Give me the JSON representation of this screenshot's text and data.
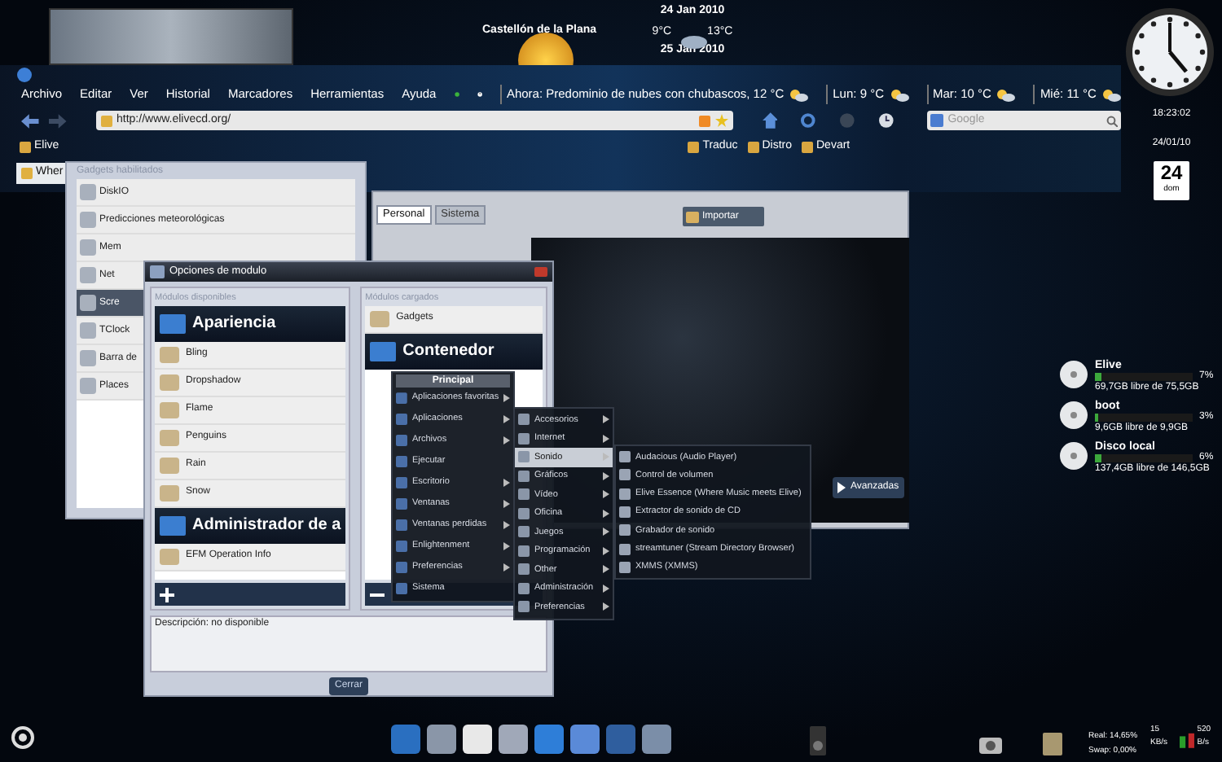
{
  "weather_gadget": {
    "city": "Castellón de la Plana",
    "date": "24 Jan 2010",
    "low": "9°C",
    "high": "13°C",
    "next_date": "25 Jan 2010"
  },
  "browser": {
    "menu": [
      "Archivo",
      "Editar",
      "Ver",
      "Historial",
      "Marcadores",
      "Herramientas",
      "Ayuda"
    ],
    "forecast": [
      "Ahora: Predominio de nubes con chubascos, 12 °C",
      "Lun: 9 °C",
      "Mar: 10 °C",
      "Mié: 11 °C"
    ],
    "url": "http://www.elivecd.org/",
    "search": {
      "placeholder": "Google"
    },
    "bookmarks": [
      "Elive",
      "Traduc",
      "Distro",
      "Devart"
    ],
    "tabs": [
      {
        "label": "Wher",
        "selected": true
      }
    ]
  },
  "clock_panel": {
    "time": "18:23:02",
    "date": "24/01/10",
    "calendar_day": "24",
    "calendar_weekday": "dom"
  },
  "gadgets_window": {
    "title": "Gadgets habilitados",
    "items": [
      {
        "label": "DiskIO",
        "selected": false
      },
      {
        "label": "Predicciones meteorológicas",
        "selected": false
      },
      {
        "label": "Mem",
        "selected": false
      },
      {
        "label": "Net",
        "selected": false
      },
      {
        "label": "Scre",
        "selected": true
      },
      {
        "label": "TClock",
        "selected": false
      },
      {
        "label": "Barra de",
        "selected": false
      },
      {
        "label": "Places",
        "selected": false
      }
    ]
  },
  "back_window": {
    "tabs": [
      {
        "label": "Personal",
        "selected": true
      },
      {
        "label": "Sistema",
        "selected": false
      }
    ],
    "import_button": "Importar",
    "advanced_button": "Avanzadas"
  },
  "module_window": {
    "title": "Opciones de modulo",
    "available_label": "Módulos disponibles",
    "loaded_label": "Módulos cargados",
    "available": [
      {
        "kind": "header",
        "label": "Apariencia"
      },
      {
        "kind": "item",
        "label": "Bling"
      },
      {
        "kind": "item",
        "label": "Dropshadow"
      },
      {
        "kind": "item",
        "label": "Flame"
      },
      {
        "kind": "item",
        "label": "Penguins"
      },
      {
        "kind": "item",
        "label": "Rain"
      },
      {
        "kind": "item",
        "label": "Snow"
      },
      {
        "kind": "header",
        "label": "Administrador de a"
      },
      {
        "kind": "item",
        "label": "EFM Operation Info"
      }
    ],
    "loaded": [
      {
        "kind": "item",
        "label": "Gadgets"
      },
      {
        "kind": "header",
        "label": "Contenedor"
      }
    ],
    "description": "Descripción: no disponible",
    "close_button": "Cerrar"
  },
  "main_menu": {
    "title": "Principal",
    "items": [
      {
        "label": "Aplicaciones favoritas",
        "has_submenu": true
      },
      {
        "label": "Aplicaciones",
        "has_submenu": true
      },
      {
        "label": "Archivos",
        "has_submenu": true
      },
      {
        "label": "Ejecutar",
        "has_submenu": false
      },
      {
        "label": "Escritorio",
        "has_submenu": true
      },
      {
        "label": "Ventanas",
        "has_submenu": true
      },
      {
        "label": "Ventanas perdidas",
        "has_submenu": true
      },
      {
        "label": "Enlightenment",
        "has_submenu": true
      },
      {
        "label": "Preferencias",
        "has_submenu": true
      },
      {
        "label": "Sistema",
        "has_submenu": false
      }
    ]
  },
  "applications_menu": {
    "items": [
      {
        "label": "Accesorios",
        "selected": false
      },
      {
        "label": "Internet",
        "selected": false
      },
      {
        "label": "Sonido",
        "selected": true
      },
      {
        "label": "Gráficos",
        "selected": false
      },
      {
        "label": "Vídeo",
        "selected": false
      },
      {
        "label": "Oficina",
        "selected": false
      },
      {
        "label": "Juegos",
        "selected": false
      },
      {
        "label": "Programación",
        "selected": false
      },
      {
        "label": "Other",
        "selected": false
      },
      {
        "label": "Administración",
        "selected": false
      },
      {
        "label": "Preferencias",
        "selected": false
      }
    ]
  },
  "sound_menu": {
    "items": [
      "Audacious (Audio Player)",
      "Control de volumen",
      "Elive Essence (Where Music meets Elive)",
      "Extractor de sonido de CD",
      "Grabador de sonido",
      "streamtuner (Stream Directory Browser)",
      "XMMS (XMMS)"
    ]
  },
  "disks": [
    {
      "name": "Elive",
      "percent": "7%",
      "level": 0.07,
      "free": "69,7GB libre de 75,5GB"
    },
    {
      "name": "boot",
      "percent": "3%",
      "level": 0.03,
      "free": "9,6GB libre de 9,9GB"
    },
    {
      "name": "Disco local",
      "percent": "6%",
      "level": 0.06,
      "free": "137,4GB libre de 146,5GB"
    }
  ],
  "system_monitor": {
    "real": "Real: 14,65%",
    "swap": "Swap: 0,00%",
    "upload": "520 B/s",
    "download": "15 KB/s"
  }
}
